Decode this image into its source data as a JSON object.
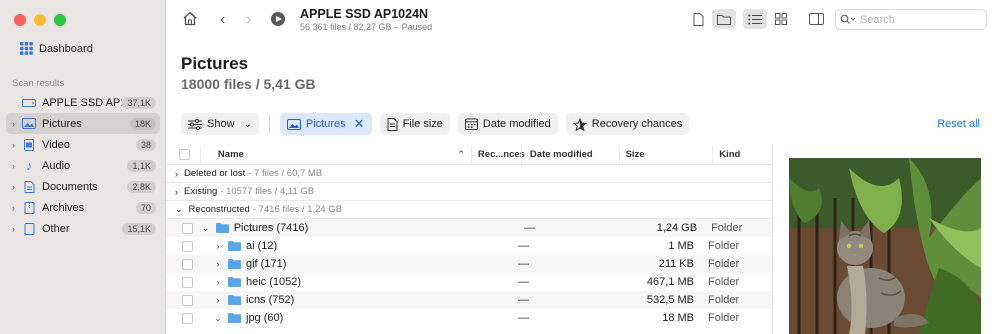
{
  "sidebar": {
    "dashboard_label": "Dashboard",
    "section_label": "Scan results",
    "items": [
      {
        "label": "APPLE SSD AP1...",
        "badge": "37,1K",
        "icon": "disk-icon",
        "chevron": false
      },
      {
        "label": "Pictures",
        "badge": "18K",
        "icon": "picture-icon",
        "chevron": true
      },
      {
        "label": "Video",
        "badge": "38",
        "icon": "video-icon",
        "chevron": true
      },
      {
        "label": "Audio",
        "badge": "1,1K",
        "icon": "music-note-icon",
        "chevron": true
      },
      {
        "label": "Documents",
        "badge": "2,8K",
        "icon": "document-icon",
        "chevron": true
      },
      {
        "label": "Archives",
        "badge": "70",
        "icon": "archive-icon",
        "chevron": true
      },
      {
        "label": "Other",
        "badge": "15,1K",
        "icon": "other-file-icon",
        "chevron": true
      }
    ]
  },
  "toolbar": {
    "title": "APPLE SSD AP1024N",
    "subtitle": "56 361 files / 82,27 GB – Paused",
    "search_placeholder": "Search"
  },
  "main": {
    "heading": "Pictures",
    "subheading": "18000 files / 5,41 GB"
  },
  "filters": {
    "show": "Show",
    "pictures": "Pictures",
    "file_size": "File size",
    "date_modified": "Date modified",
    "recovery_chances": "Recovery chances",
    "reset_all": "Reset all"
  },
  "table": {
    "columns": {
      "name": "Name",
      "rec": "Rec...nces",
      "date": "Date modified",
      "size": "Size",
      "kind": "Kind"
    },
    "groups": [
      {
        "name": "Deleted or lost",
        "info": "- 7 files / 60,7 MB"
      },
      {
        "name": "Existing",
        "info": "- 10577 files / 4,11 GB"
      },
      {
        "name": "Reconstructed",
        "info": "- 7416 files / 1,24 GB"
      }
    ],
    "rows": [
      {
        "name": "Pictures (7416)",
        "date": "—",
        "size": "1,24 GB",
        "kind": "Folder"
      },
      {
        "name": "ai (12)",
        "date": "—",
        "size": "1 MB",
        "kind": "Folder"
      },
      {
        "name": "gif (171)",
        "date": "—",
        "size": "211 KB",
        "kind": "Folder"
      },
      {
        "name": "heic (1052)",
        "date": "—",
        "size": "467,1 MB",
        "kind": "Folder"
      },
      {
        "name": "icns (752)",
        "date": "—",
        "size": "532,5 MB",
        "kind": "Folder"
      },
      {
        "name": "jpg (60)",
        "date": "—",
        "size": "18 MB",
        "kind": "Folder"
      }
    ]
  },
  "colors": {
    "accent": "#1f6fe0",
    "folder": "#5aa4e8"
  }
}
